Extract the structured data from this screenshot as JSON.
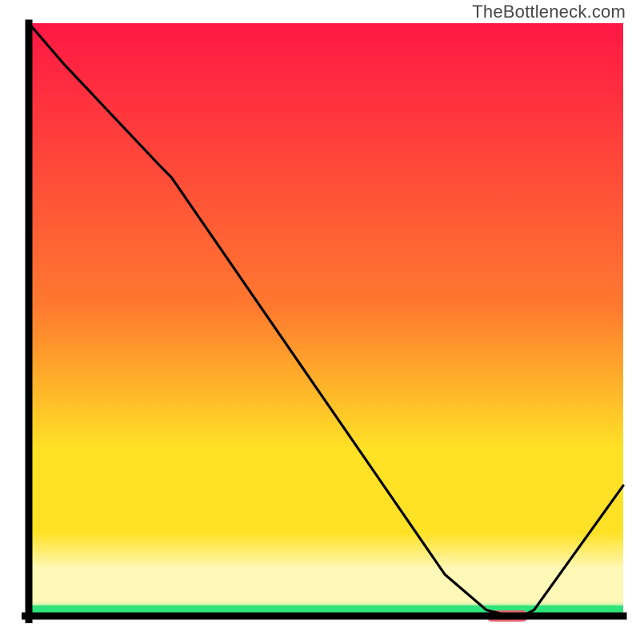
{
  "watermark": "TheBottleneck.com",
  "colors": {
    "axis": "#000000",
    "curve": "#000000",
    "marker": "#e2626e",
    "gradient_top": "#ff1744",
    "gradient_mid1": "#ff7a2f",
    "gradient_mid2": "#ffe226",
    "gradient_yellow_pale": "#fff8b7",
    "gradient_green": "#2fe47a"
  },
  "layout": {
    "plot_left": 36,
    "plot_right": 779,
    "plot_top": 29,
    "plot_bottom": 770,
    "axis_width": 9
  },
  "chart_data": {
    "type": "line",
    "title": "",
    "xlabel": "",
    "ylabel": "",
    "xlim": [
      0,
      100
    ],
    "ylim": [
      0,
      100
    ],
    "x": [
      0,
      6,
      22,
      24,
      70,
      77,
      81,
      83,
      85,
      100
    ],
    "values": [
      100,
      93,
      76,
      74,
      7,
      1,
      0,
      0,
      1,
      22
    ],
    "marker": {
      "x_start": 77,
      "x_end": 84,
      "y": 0
    },
    "gradient_stops": [
      {
        "pct": 0,
        "color_key": "gradient_top"
      },
      {
        "pct": 48,
        "color_key": "gradient_mid1"
      },
      {
        "pct": 72,
        "color_key": "gradient_mid2"
      },
      {
        "pct": 86,
        "color_key": "gradient_mid2"
      },
      {
        "pct": 92,
        "color_key": "gradient_yellow_pale"
      },
      {
        "pct": 97.5,
        "color_key": "gradient_yellow_pale"
      },
      {
        "pct": 100,
        "color_key": "gradient_green"
      }
    ]
  }
}
